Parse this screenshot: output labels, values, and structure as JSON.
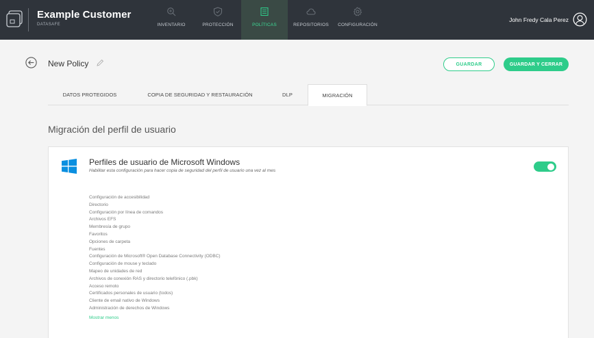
{
  "app": {
    "title": "Example Customer",
    "subtitle": "DATASAFE"
  },
  "nav": {
    "items": [
      {
        "label": "INVENTARIO",
        "icon": "search-icon",
        "active": false
      },
      {
        "label": "PROTECCIÓN",
        "icon": "shield-icon",
        "active": false
      },
      {
        "label": "POLÍTICAS",
        "icon": "document-icon",
        "active": true
      },
      {
        "label": "REPOSITORIOS",
        "icon": "cloud-icon",
        "active": false
      },
      {
        "label": "CONFIGURACIÓN",
        "icon": "gear-icon",
        "active": false
      }
    ]
  },
  "user": {
    "name": "John Fredy Cala Perez"
  },
  "header": {
    "policy_name": "New Policy",
    "save_label": "GUARDAR",
    "save_close_label": "GUARDAR Y CERRAR"
  },
  "tabs": [
    {
      "label": "DATOS PROTEGIDOS",
      "active": false
    },
    {
      "label": "COPIA DE SEGURIDAD Y RESTAURACIÓN",
      "active": false
    },
    {
      "label": "DLP",
      "active": false
    },
    {
      "label": "MIGRACIÓN",
      "active": true
    }
  ],
  "section": {
    "title": "Migración del perfil de usuario"
  },
  "card": {
    "title": "Perfiles de usuario de Microsoft Windows",
    "subtitle": "Habilitar esta configuración para hacer copia de seguridad del perfil de usuario una vez al mes",
    "toggle_on": true,
    "items": [
      "Configuración de accesibilidad",
      "Directorio",
      "Configuración por línea de comandos",
      "Archivos EFS",
      "Membresía de grupo",
      "Favoritos",
      "Opciones de carpeta",
      "Fuentes",
      "Configuración de Microsoft® Open Database Connectivity (ODBC)",
      "Configuración de mouse y teclado",
      "Mapeo de unidades de red",
      "Archivos de conexión RAS y directorio telefónico (.pbk)",
      "Acceso remoto",
      "Certificados personales de usuario (todos)",
      "Cliente de email nativo de Windows",
      "Administración de derechos de Windows"
    ],
    "show_less_label": "Mostrar menos"
  },
  "colors": {
    "topbar": "#2f343b",
    "accent": "#2ecc8a",
    "windows_blue": "#0a8fe0"
  }
}
